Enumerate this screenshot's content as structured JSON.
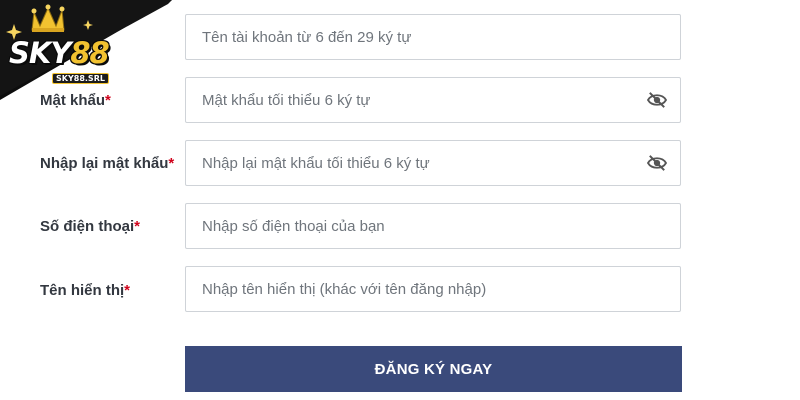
{
  "logo": {
    "brand_main": "SKY",
    "brand_num": "88",
    "domain": "SKY88.SRL",
    "colors": {
      "gold": "#f2c230",
      "dark": "#111111"
    }
  },
  "form": {
    "fields": [
      {
        "label": "",
        "placeholder": "Tên tài khoản từ 6 đến 29 ký tự"
      },
      {
        "label": "Mật khẩu",
        "placeholder": "Mật khẩu tối thiểu 6 ký tự",
        "icon": "eye-off-icon"
      },
      {
        "label": "Nhập lại mật khẩu",
        "placeholder": "Nhập lại mật khẩu tối thiểu 6 ký tự",
        "icon": "eye-off-icon"
      },
      {
        "label": "Số điện thoại",
        "placeholder": "Nhập số điện thoại của bạn"
      },
      {
        "label": "Tên hiển thị",
        "placeholder": "Nhập tên hiển thị (khác với tên đăng nhập)"
      }
    ],
    "required_mark": "*",
    "submit_label": "ĐĂNG KÝ NGAY",
    "colors": {
      "button": "#3a4a7b",
      "required": "#d0021b"
    }
  }
}
